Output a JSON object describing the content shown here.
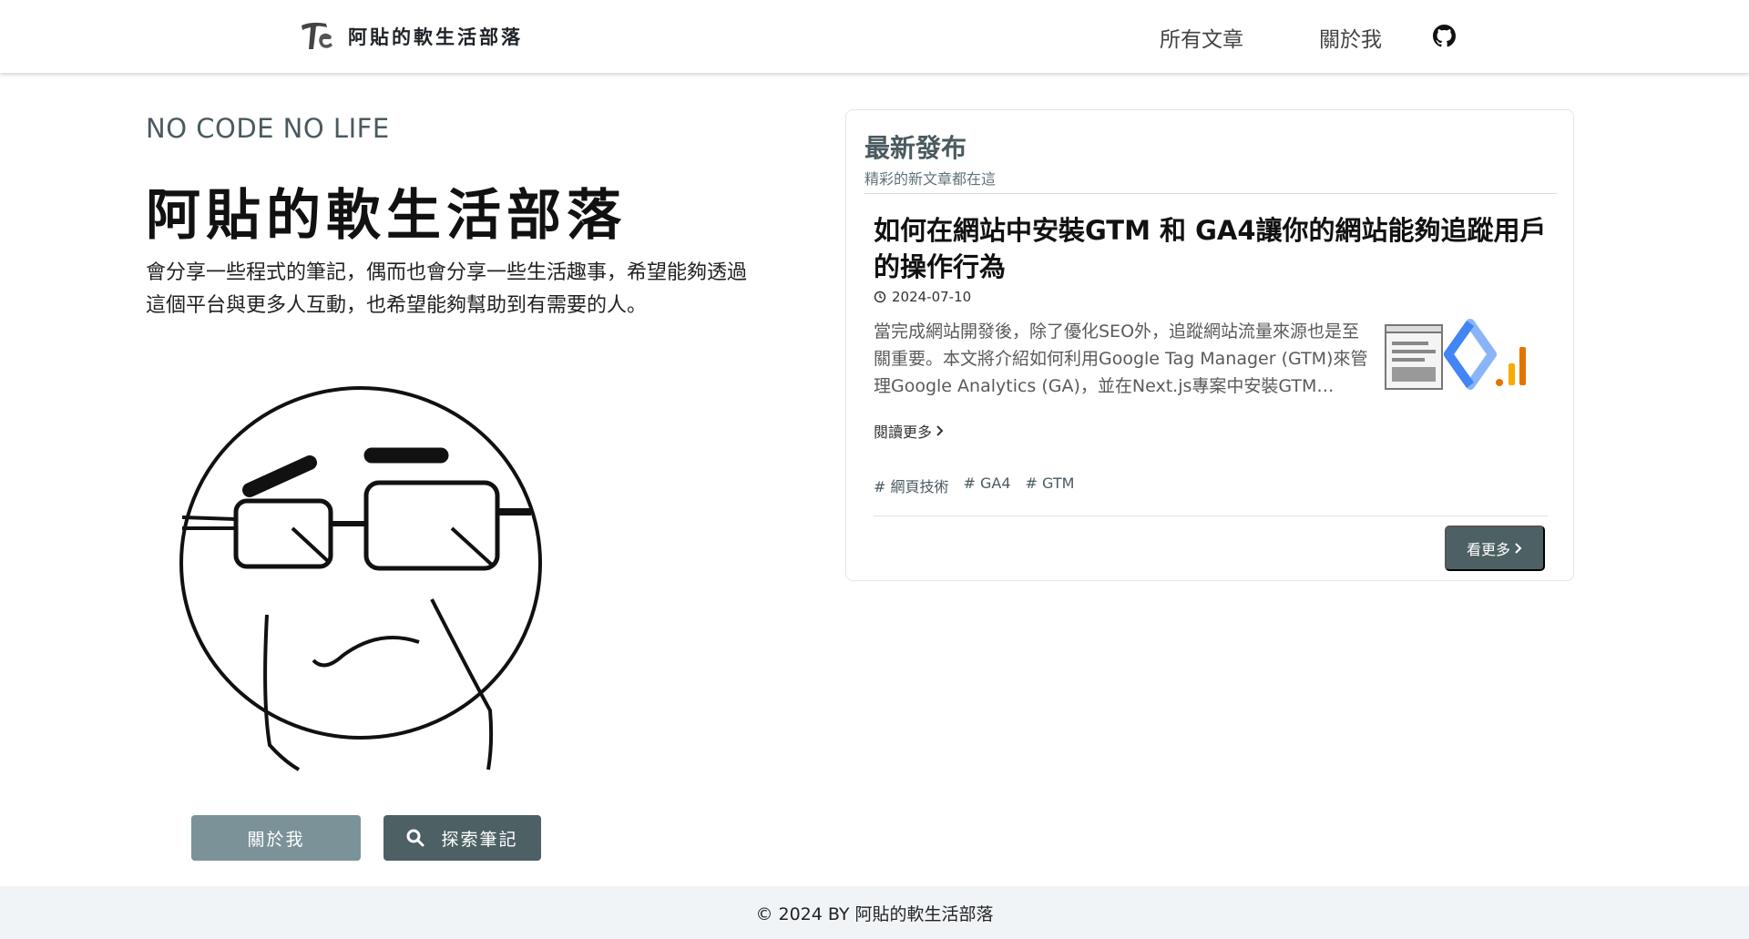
{
  "header": {
    "brand_name": "阿貼的軟生活部落",
    "nav": {
      "posts_label": "所有文章",
      "about_label": "關於我"
    },
    "github_icon": "github-icon"
  },
  "hero": {
    "tagline": "NO CODE NO LIFE",
    "title": "阿貼的軟生活部落",
    "description": "會分享一些程式的筆記，偶而也會分享一些生活趣事，希望能夠透過這個平台與更多人互動，也希望能夠幫助到有需要的人。",
    "about_button": "關於我",
    "explore_button": "探索筆記"
  },
  "latest": {
    "heading": "最新發布",
    "subheading": "精彩的新文章都在這",
    "post": {
      "title": "如何在網站中安裝GTM 和 GA4讓你的網站能夠追蹤用戶的操作行為",
      "date": "2024-07-10",
      "excerpt": "當完成網站開發後，除了優化SEO外，追蹤網站流量來源也是至關重要。本文將介紹如何利用Google Tag Manager (GTM)來管理Google Analytics (GA)，並在Next.js專案中安裝GTM…",
      "read_more": "閱讀更多",
      "tags": [
        "# 網頁技術",
        "# GA4",
        "# GTM"
      ]
    },
    "more_button": "看更多"
  },
  "footer": {
    "copyright": "© 2024 BY 阿貼的軟生活部落"
  },
  "colors": {
    "accent_dark": "#4d6165",
    "accent_light": "#7b9298",
    "footer_bg": "#f1f4f7"
  }
}
